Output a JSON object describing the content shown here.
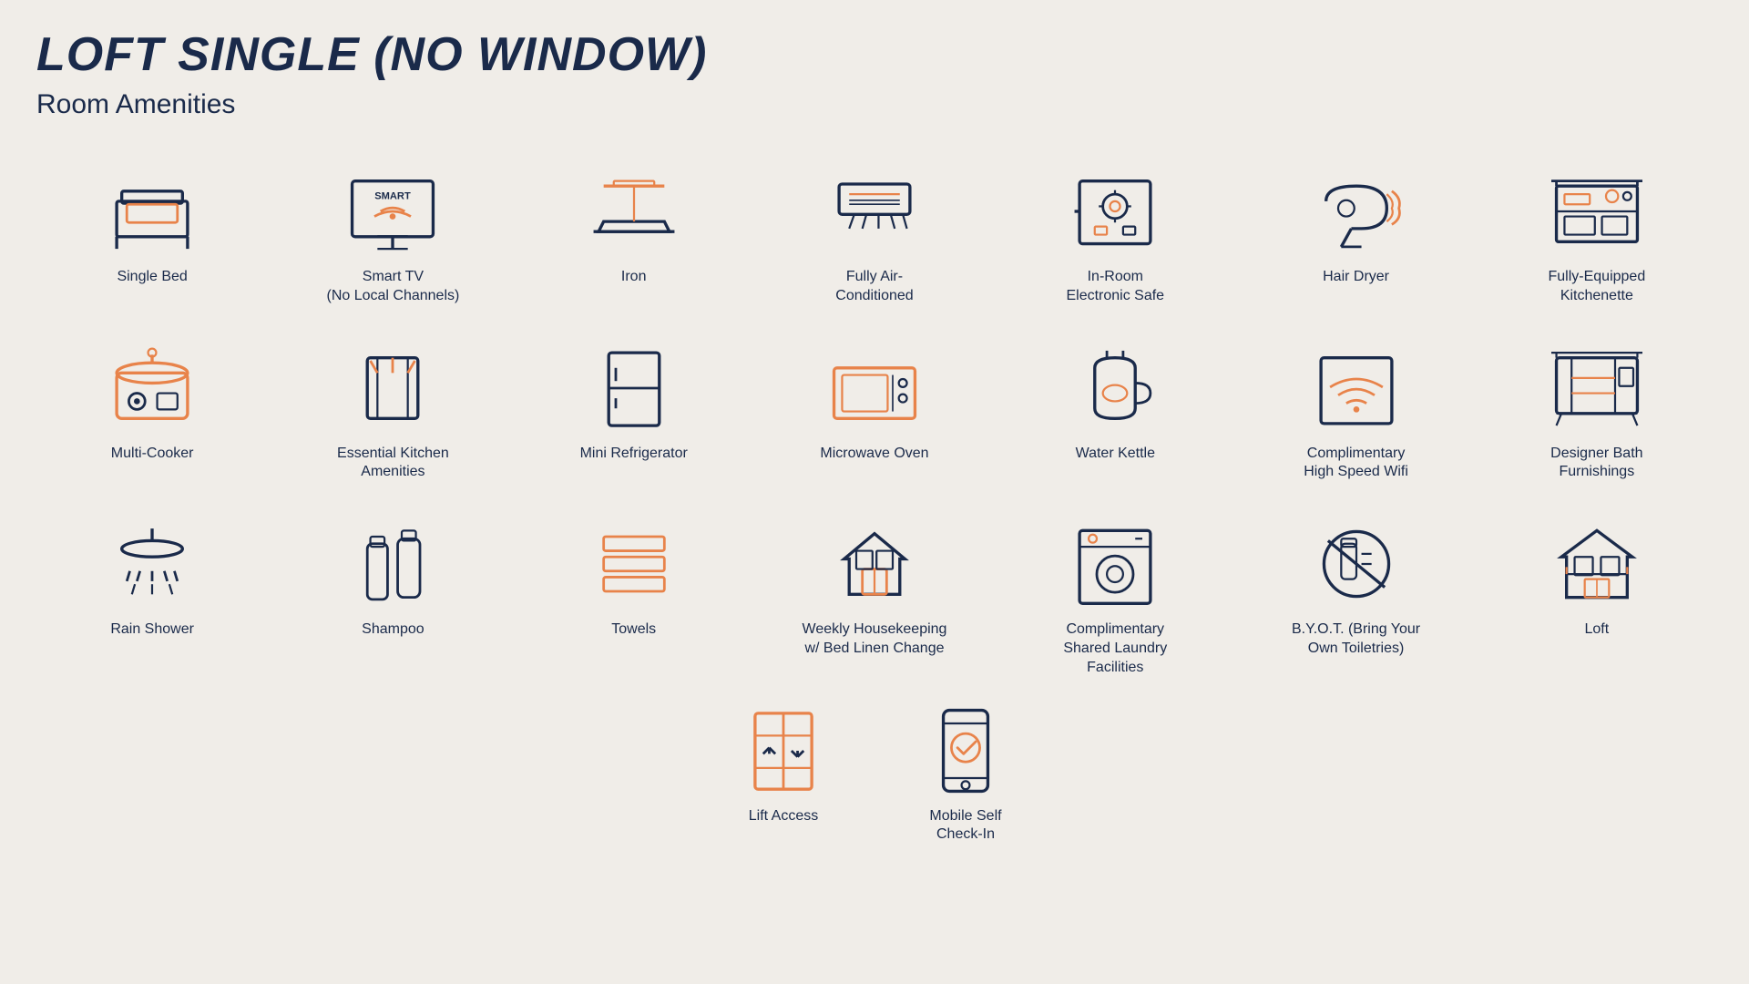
{
  "title": "LOFT SINGLE (NO WINDOW)",
  "subtitle": "Room Amenities",
  "amenities": [
    {
      "id": "single-bed",
      "label": "Single Bed"
    },
    {
      "id": "smart-tv",
      "label": "Smart TV\n(No Local Channels)"
    },
    {
      "id": "iron",
      "label": "Iron"
    },
    {
      "id": "air-conditioned",
      "label": "Fully Air-\nConditioned"
    },
    {
      "id": "electronic-safe",
      "label": "In-Room\nElectronic Safe"
    },
    {
      "id": "hair-dryer",
      "label": "Hair Dryer"
    },
    {
      "id": "kitchenette",
      "label": "Fully-Equipped\nKitchenette"
    },
    {
      "id": "multi-cooker",
      "label": "Multi-Cooker"
    },
    {
      "id": "kitchen-amenities",
      "label": "Essential Kitchen\nAmenities"
    },
    {
      "id": "mini-refrigerator",
      "label": "Mini Refrigerator"
    },
    {
      "id": "microwave-oven",
      "label": "Microwave Oven"
    },
    {
      "id": "water-kettle",
      "label": "Water Kettle"
    },
    {
      "id": "wifi",
      "label": "Complimentary\nHigh Speed Wifi"
    },
    {
      "id": "designer-bath",
      "label": "Designer Bath\nFurnishings"
    },
    {
      "id": "rain-shower",
      "label": "Rain Shower"
    },
    {
      "id": "shampoo",
      "label": "Shampoo"
    },
    {
      "id": "towels",
      "label": "Towels"
    },
    {
      "id": "housekeeping",
      "label": "Weekly Housekeeping\nw/ Bed Linen Change"
    },
    {
      "id": "laundry",
      "label": "Complimentary\nShared Laundry\nFacilities"
    },
    {
      "id": "byot",
      "label": "B.Y.O.T. (Bring Your\nOwn Toiletries)"
    },
    {
      "id": "loft",
      "label": "Loft"
    }
  ],
  "bottom_amenities": [
    {
      "id": "lift-access",
      "label": "Lift Access"
    },
    {
      "id": "mobile-checkin",
      "label": "Mobile Self\nCheck-In"
    }
  ]
}
